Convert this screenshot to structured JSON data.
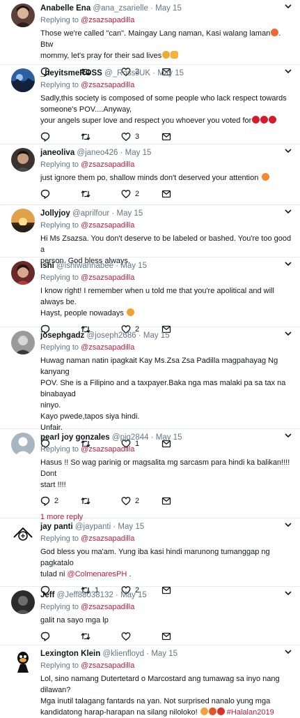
{
  "tweets": [
    {
      "name": "Anabelle Ena",
      "handle": "@ana_zsarielle",
      "date": "May 15",
      "replying_label": "Replying to",
      "replying_to": "@zsazsapadilla",
      "lines": [
        "Those we're called \"can\". Maingay Lang naman, Kasi walang laman",
        "mommy, let's pray for their sad lives"
      ],
      "line_tails": [
        ". Btw",
        ""
      ],
      "counts": {
        "reply": "",
        "retweet": "",
        "like": "3"
      }
    },
    {
      "name": "_heyitsmeROSS",
      "handle": "@_RosssUK",
      "date": "May 15",
      "replying_label": "Replying to",
      "replying_to": "@zsazsapadilla",
      "lines": [
        "Sadly,this society is composed of some people who lack respect towards",
        "someone's POV....Anyway,",
        "your angels super love and respect you whoever you voted for"
      ],
      "counts": {
        "reply": "",
        "retweet": "",
        "like": "3"
      }
    },
    {
      "name": "janeoliva",
      "handle": "@janeo426",
      "date": "May 15",
      "replying_label": "Replying to",
      "replying_to": "@zsazsapadilla",
      "lines": [
        "just ignore them po, shallow minds don't deserved your attention"
      ],
      "counts": {
        "reply": "",
        "retweet": "",
        "like": "2"
      }
    },
    {
      "name": "Jollyjoy",
      "handle": "@aprilfour",
      "date": "May 15",
      "replying_label": "Replying to",
      "replying_to": "@zsazsapadilla",
      "lines": [
        "Hi Ms Zsazsa. You don't deserve to be labeled or bashed. You're too good a",
        "person. God bless always."
      ],
      "counts": {
        "reply": "",
        "retweet": "",
        "like": ""
      }
    },
    {
      "name": "ishi",
      "handle": "@ishiwannabee",
      "date": "May 15",
      "replying_label": "Replying to",
      "replying_to": "@zsazsapadilla",
      "lines": [
        "I know right! I remember when u told me that you're apolitical and will always be.",
        "Hayst, people nowadays"
      ],
      "counts": {
        "reply": "",
        "retweet": "",
        "like": "2"
      }
    },
    {
      "name": "josephgadz",
      "handle": "@joseph2686",
      "date": "May 15",
      "replying_label": "Replying to",
      "replying_to": "@zsazsapadilla",
      "lines": [
        "Huwag naman natin ipagkait Kay Ms.Zsa Zsa Padilla magpahayag Ng kanyang",
        "POV. She is a Filipino and a taxpayer.Baka nga mas malaki pa sa tax na binabayad",
        "ninyo.",
        "Kayo pwede,tapos siya hindi.",
        "Unfair."
      ],
      "counts": {
        "reply": "",
        "retweet": "",
        "like": "1"
      }
    },
    {
      "name": "pearl joy gonzales",
      "handle": "@pjg2844",
      "date": "May 15",
      "replying_label": "Replying to",
      "replying_to": "@zsazsapadilla",
      "lines": [
        "Hasus !! So wag parinig or magsalita mg sarcasm para hindi ka balikan!!!! Dont",
        "start !!!!"
      ],
      "counts": {
        "reply": "2",
        "retweet": "",
        "like": "2"
      },
      "more_replies": "1 more reply"
    },
    {
      "name": "jay panti",
      "handle": "@jaypanti",
      "date": "May 15",
      "replying_label": "Replying to",
      "replying_to": "@zsazsapadilla",
      "lines": [
        "God bless you ma'am. Yung iba kasi hindi marunong tumanggap ng pagkatalo",
        "tulad ni"
      ],
      "mention": "@ColmenaresPH",
      "counts": {
        "reply": "",
        "retweet": "1",
        "like": "2"
      }
    },
    {
      "name": "Jeff",
      "handle": "@Jeff88038132",
      "date": "May 15",
      "replying_label": "Replying to",
      "replying_to": "@zsazsapadilla",
      "lines": [
        "galit na sayo mga lp"
      ],
      "counts": {
        "reply": "",
        "retweet": "",
        "like": ""
      }
    },
    {
      "name": "Lexington Klein",
      "handle": "@klienfloyd",
      "date": "May 15",
      "replying_label": "Replying to",
      "replying_to": "@zsazsapadilla",
      "lines": [
        "Lol, sino namang Dutertetard o Marcostard ang tumawag sa inyo nang dilawan?",
        "Mga inutil talagang fantards na yan. Not surprised nanalo yung mga",
        "kandidatong harap-harapan na silang niloloko!"
      ],
      "hashtag": "#Halalan2019",
      "counts": {
        "reply": "",
        "retweet": "",
        "like": ""
      }
    }
  ],
  "icons": {
    "reply": "reply-icon",
    "retweet": "retweet-icon",
    "like": "like-icon",
    "message": "message-icon",
    "more": "chevron-down-icon"
  },
  "colors": {
    "mention": "#bc1c3c",
    "secondary": "#657786",
    "divider": "#e6ecf0"
  }
}
